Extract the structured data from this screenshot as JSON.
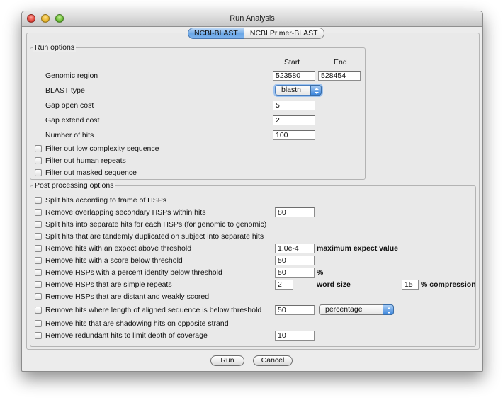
{
  "window": {
    "title": "Run Analysis"
  },
  "tabs": [
    {
      "label": "NCBI-BLAST",
      "active": true
    },
    {
      "label": "NCBI Primer-BLAST",
      "active": false
    }
  ],
  "run_options": {
    "title": "Run options",
    "col_start": "Start",
    "col_end": "End",
    "genomic_region": {
      "label": "Genomic region",
      "start": "523580",
      "end": "528454"
    },
    "blast_type": {
      "label": "BLAST type",
      "value": "blastn"
    },
    "gap_open": {
      "label": "Gap open cost",
      "value": "5"
    },
    "gap_extend": {
      "label": "Gap extend cost",
      "value": "2"
    },
    "num_hits": {
      "label": "Number of hits",
      "value": "100"
    },
    "checkboxes": [
      {
        "label": "Filter out low complexity sequence",
        "checked": false
      },
      {
        "label": "Filter out human repeats",
        "checked": false
      },
      {
        "label": "Filter out masked sequence",
        "checked": false
      }
    ]
  },
  "post_options": {
    "title": "Post processing options",
    "items": [
      {
        "label": "Split hits according to frame of HSPs",
        "checked": false
      },
      {
        "label": "Remove overlapping secondary HSPs within hits",
        "checked": false,
        "value": "80"
      },
      {
        "label": "Split hits into separate hits for each HSPs (for genomic to genomic)",
        "checked": false
      },
      {
        "label": "Split hits that are tandemly duplicated on subject into separate hits",
        "checked": false
      },
      {
        "label": "Remove hits with an expect above threshold",
        "checked": false,
        "value": "1.0e-4",
        "suffix": "maximum expect value"
      },
      {
        "label": "Remove hits with a score below threshold",
        "checked": false,
        "value": "50"
      },
      {
        "label": "Remove HSPs with a percent identity below threshold",
        "checked": false,
        "value": "50",
        "suffix": "%"
      },
      {
        "label": "Remove HSPs that are simple repeats",
        "checked": false,
        "value": "2",
        "suffix": "word size",
        "value2": "15",
        "suffix2": "% compression"
      },
      {
        "label": "Remove HSPs that are distant and weakly scored",
        "checked": false
      },
      {
        "label": "Remove hits where length of aligned sequence is below threshold",
        "checked": false,
        "value": "50",
        "select": "percentage"
      },
      {
        "label": "Remove hits that are shadowing hits on opposite strand",
        "checked": false
      },
      {
        "label": "Remove redundant hits to limit depth of coverage",
        "checked": false,
        "value": "10"
      }
    ]
  },
  "buttons": {
    "run": "Run",
    "cancel": "Cancel"
  },
  "icons": {
    "traffic_lights": [
      "close-icon",
      "minimize-icon",
      "zoom-icon"
    ],
    "popup_arrow": "updown-arrows-icon"
  }
}
